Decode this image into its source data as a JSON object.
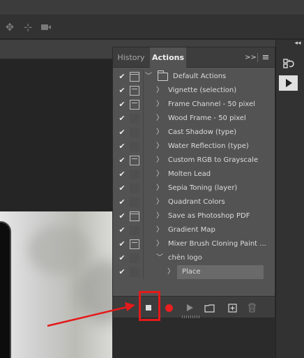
{
  "toolbar": {
    "icons": [
      "align-icon",
      "move-icon",
      "video-icon"
    ]
  },
  "panel": {
    "tabs": [
      {
        "label": "History",
        "active": false
      },
      {
        "label": "Actions",
        "active": true
      }
    ],
    "expand_glyph": ">>",
    "menu_glyph": "≡",
    "actions": [
      {
        "label": "Default Actions",
        "checked": true,
        "dialog": "set",
        "type": "set",
        "expanded": true
      },
      {
        "label": "Vignette (selection)",
        "checked": true,
        "dialog": "on",
        "type": "action"
      },
      {
        "label": "Frame Channel - 50 pixel",
        "checked": true,
        "dialog": "on",
        "type": "action"
      },
      {
        "label": "Wood Frame - 50 pixel",
        "checked": true,
        "dialog": "off",
        "type": "action"
      },
      {
        "label": "Cast Shadow (type)",
        "checked": true,
        "dialog": "off",
        "type": "action"
      },
      {
        "label": "Water Reflection (type)",
        "checked": true,
        "dialog": "off",
        "type": "action"
      },
      {
        "label": "Custom RGB to Grayscale",
        "checked": true,
        "dialog": "on",
        "type": "action"
      },
      {
        "label": "Molten Lead",
        "checked": true,
        "dialog": "off",
        "type": "action"
      },
      {
        "label": "Sepia Toning (layer)",
        "checked": true,
        "dialog": "off",
        "type": "action"
      },
      {
        "label": "Quadrant Colors",
        "checked": true,
        "dialog": "off",
        "type": "action"
      },
      {
        "label": "Save as Photoshop PDF",
        "checked": true,
        "dialog": "set",
        "type": "action"
      },
      {
        "label": "Gradient Map",
        "checked": true,
        "dialog": "off",
        "type": "action"
      },
      {
        "label": "Mixer Brush Cloning Paint ...",
        "checked": true,
        "dialog": "on",
        "type": "action"
      },
      {
        "label": "chèn logo",
        "checked": true,
        "dialog": "off",
        "type": "action",
        "expanded": true
      },
      {
        "label": "Place",
        "checked": true,
        "dialog": "off",
        "type": "command",
        "selected": true
      }
    ],
    "footer_buttons": [
      {
        "name": "stop-playing-recording-button",
        "icon": "stop-icon"
      },
      {
        "name": "begin-recording-button",
        "icon": "record-icon"
      },
      {
        "name": "play-selection-button",
        "icon": "play-icon"
      },
      {
        "name": "create-new-set-button",
        "icon": "folder-icon"
      },
      {
        "name": "create-new-action-button",
        "icon": "new-item-icon"
      },
      {
        "name": "delete-button",
        "icon": "trash-icon"
      }
    ]
  },
  "annotation": {
    "arrow_color": "#e41a1a",
    "highlight_target": "stop-playing-recording-button"
  },
  "colors": {
    "panel_bg": "#535353",
    "tab_bar": "#3d3d3d",
    "record_red": "#ea1f1f"
  }
}
